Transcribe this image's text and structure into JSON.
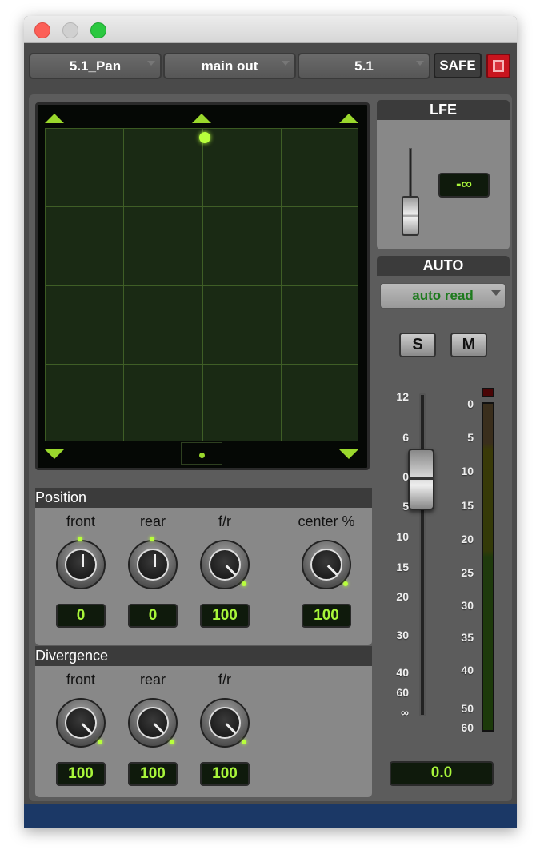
{
  "toolbar": {
    "plugin": "5.1_Pan",
    "output": "main out",
    "format": "5.1",
    "safe": "SAFE"
  },
  "position": {
    "title": "Position",
    "knobs": [
      {
        "label": "front",
        "value": "0"
      },
      {
        "label": "rear",
        "value": "0"
      },
      {
        "label": "f/r",
        "value": "100"
      },
      {
        "label": "center %",
        "value": "100"
      }
    ]
  },
  "divergence": {
    "title": "Divergence",
    "knobs": [
      {
        "label": "front",
        "value": "100"
      },
      {
        "label": "rear",
        "value": "100"
      },
      {
        "label": "f/r",
        "value": "100"
      }
    ]
  },
  "lfe": {
    "title": "LFE",
    "value": "-∞"
  },
  "auto": {
    "title": "AUTO",
    "mode": "auto read"
  },
  "buttons": {
    "solo": "S",
    "mute": "M"
  },
  "fader": {
    "scale": [
      "12",
      "6",
      "0",
      "5",
      "10",
      "15",
      "20",
      "30",
      "40",
      "60",
      "∞"
    ],
    "value": "0.0"
  },
  "meter": {
    "scale": [
      "0",
      "5",
      "10",
      "15",
      "20",
      "25",
      "30",
      "35",
      "40",
      "50",
      "60"
    ]
  },
  "colors": {
    "accent": "#a8f53a",
    "rec": "#c8141e",
    "bottom": "#1b3866"
  }
}
